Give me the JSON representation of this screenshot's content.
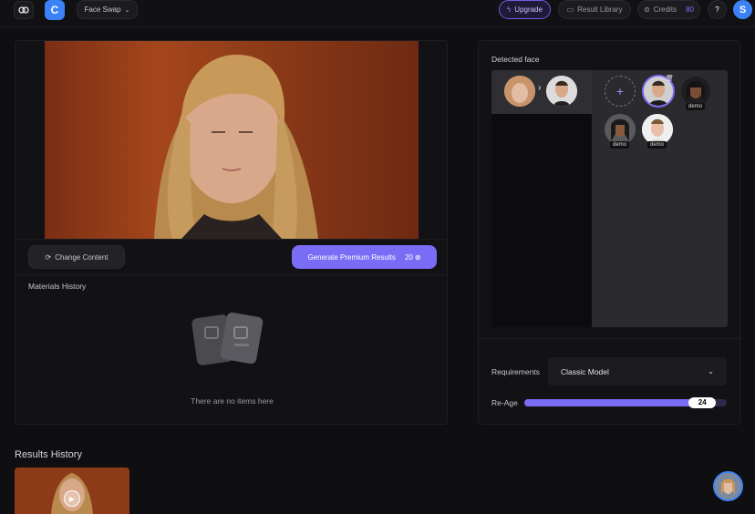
{
  "header": {
    "app_letter": "C",
    "tool_name": "Face Swap",
    "upgrade_label": "Upgrade",
    "result_library_label": "Result Library",
    "credits_label": "Credits",
    "credits_value": "80",
    "help_label": "?",
    "user_initial": "S"
  },
  "editor": {
    "change_content_label": "Change Content",
    "generate_label": "Generate Premium Results",
    "generate_cost": "20",
    "materials_history_title": "Materials History",
    "empty_text": "There are no items here"
  },
  "faces": {
    "title": "Detected face",
    "demo_label": "demo",
    "add_label": "+"
  },
  "settings": {
    "requirements_label": "Requirements",
    "requirements_value": "Classic Model",
    "reage_label": "Re-Age",
    "reage_value": "24",
    "reage_fraction": 0.92
  },
  "results": {
    "title": "Results History"
  },
  "colors": {
    "accent": "#7b6cf6",
    "brand_blue": "#3b82f6"
  }
}
